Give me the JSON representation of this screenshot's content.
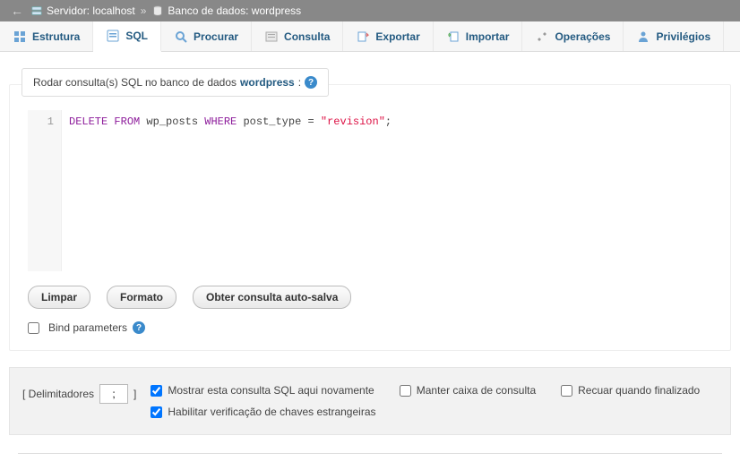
{
  "breadcrumb": {
    "back": "←",
    "server_label": "Servidor: localhost",
    "separator": "»",
    "db_label": "Banco de dados: wordpress"
  },
  "tabs": {
    "estrutura": "Estrutura",
    "sql": "SQL",
    "procurar": "Procurar",
    "consulta": "Consulta",
    "exportar": "Exportar",
    "importar": "Importar",
    "operacoes": "Operações",
    "privilegios": "Privilégios"
  },
  "panel": {
    "title_prefix": "Rodar consulta(s) SQL no banco de dados ",
    "title_dbname": "wordpress",
    "title_suffix": ":"
  },
  "editor": {
    "line_number": "1",
    "kw_delete": "DELETE",
    "kw_from": "FROM",
    "tbl": " wp_posts ",
    "kw_where": "WHERE",
    "col": " post_type = ",
    "str": "\"revision\"",
    "tail": ";"
  },
  "buttons": {
    "limpar": "Limpar",
    "formato": "Formato",
    "auto_salva": "Obter consulta auto-salva"
  },
  "bind": {
    "label": "Bind parameters",
    "help": "?"
  },
  "bottom": {
    "delim_label_open": "[ Delimitadores",
    "delim_value": ";",
    "delim_label_close": "]",
    "opt_show_again": "Mostrar esta consulta SQL aqui novamente",
    "opt_keep_box": "Manter caixa de consulta",
    "opt_rollback": "Recuar quando finalizado",
    "opt_fk": "Habilitar verificação de chaves estrangeiras"
  }
}
